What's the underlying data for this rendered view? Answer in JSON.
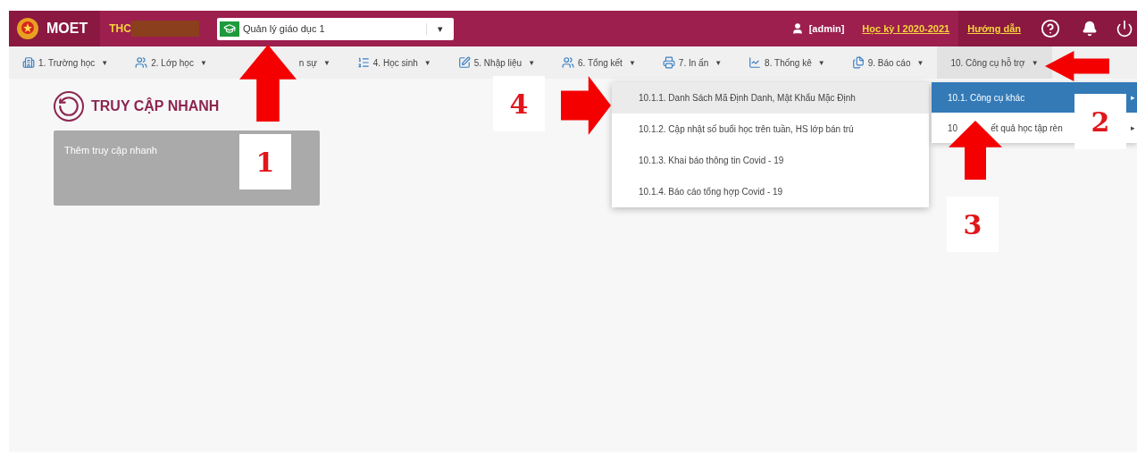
{
  "header": {
    "brand": "MOET",
    "school": "THC",
    "school_redacted": true,
    "module_select": {
      "value": "Quản lý giáo dục 1",
      "caret": "▾"
    },
    "user": "[admin]",
    "term_link": "Học kỳ I 2020-2021",
    "help_link": "Hướng dẫn"
  },
  "nav": [
    {
      "label": "1. Trường học",
      "caret": "▼",
      "selected": false
    },
    {
      "label": "2. Lớp học",
      "caret": "▼",
      "selected": false
    },
    {
      "label": "n sự",
      "caret": "▼",
      "selected": false
    },
    {
      "label": "4. Học sinh",
      "caret": "▼",
      "selected": false
    },
    {
      "label": "5. Nhập liệu",
      "caret": "▼",
      "selected": false
    },
    {
      "label": "6. Tổng kết",
      "caret": "▼",
      "selected": false
    },
    {
      "label": "7. In ấn",
      "caret": "▼",
      "selected": false
    },
    {
      "label": "8. Thống kê",
      "caret": "▼",
      "selected": false
    },
    {
      "label": "9. Báo cáo",
      "caret": "▼",
      "selected": false
    },
    {
      "label": "10. Công cụ hỗ trợ",
      "caret": "▼",
      "selected": true
    }
  ],
  "quick_access": {
    "title": "TRUY CẬP NHANH",
    "card_text": "Thêm truy cập nhanh"
  },
  "submenu": [
    {
      "text": "10.1. Công cụ khác",
      "caret": "▸",
      "selected": true
    },
    {
      "text": "10",
      "text_2": "ết quả học tập rèn",
      "caret": "▸",
      "selected": false
    }
  ],
  "dropdown": [
    {
      "label": "10.1.1. Danh Sách Mã Định Danh, Mật Khẩu Mặc Định",
      "hovered": true
    },
    {
      "label": "10.1.2. Cập nhật số buổi học trên tuần, HS lớp bán trú",
      "hovered": false
    },
    {
      "label": "10.1.3. Khai báo thông tin Covid - 19",
      "hovered": false
    },
    {
      "label": "10.1.4. Báo cáo tổng hợp Covid - 19",
      "hovered": false
    }
  ],
  "annotations": [
    {
      "kind": "arrow"
    },
    {
      "kind": "label",
      "text": "1"
    },
    {
      "kind": "arrow"
    },
    {
      "kind": "label",
      "text": "2"
    },
    {
      "kind": "arrow"
    },
    {
      "kind": "label",
      "text": "3"
    },
    {
      "kind": "label",
      "text": "4"
    },
    {
      "kind": "arrow"
    }
  ]
}
